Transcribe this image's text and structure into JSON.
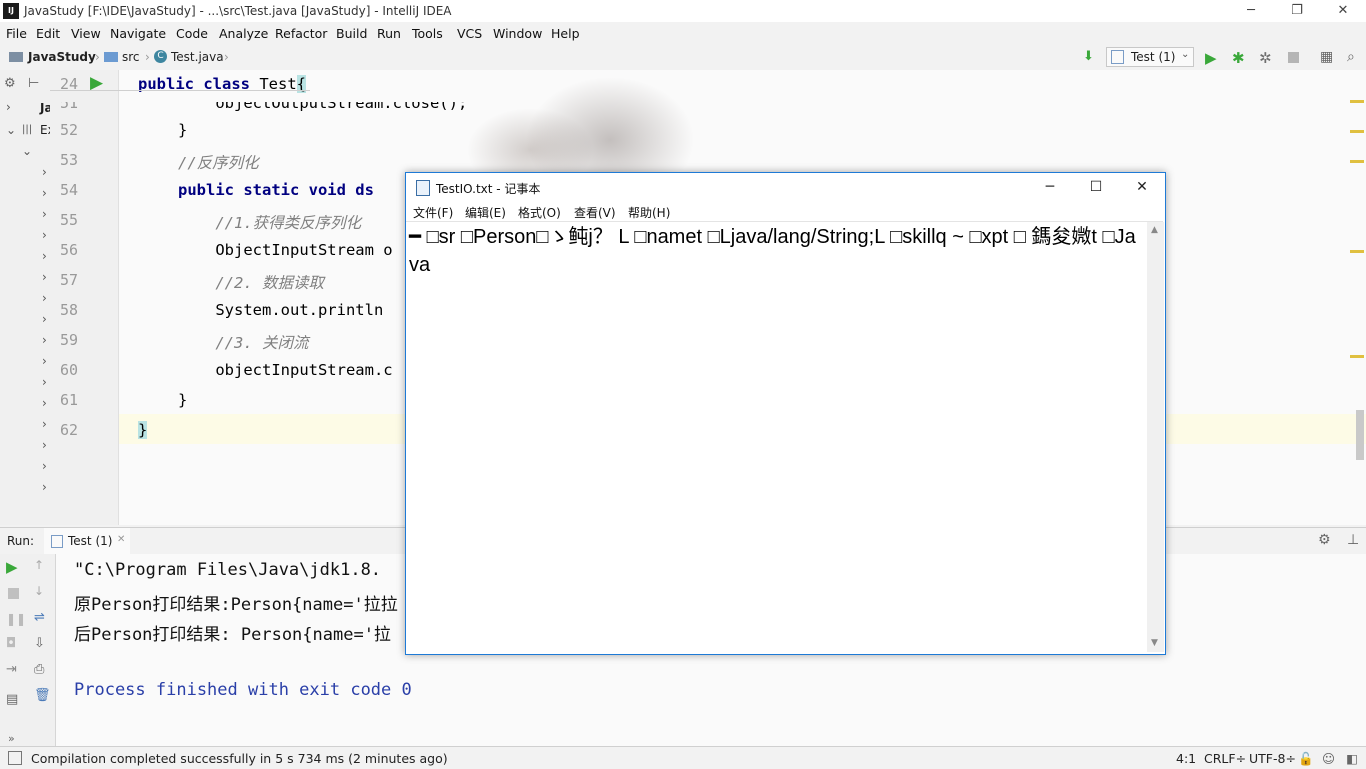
{
  "window": {
    "title": "JavaStudy [F:\\IDE\\JavaStudy] - ...\\src\\Test.java [JavaStudy] - IntelliJ IDEA",
    "logo": "IJ"
  },
  "menu": [
    "File",
    "Edit",
    "View",
    "Navigate",
    "Code",
    "Analyze",
    "Refactor",
    "Build",
    "Run",
    "Tools",
    "VCS",
    "Window",
    "Help"
  ],
  "breadcrumbs": [
    "JavaStudy",
    "src",
    "Test.java"
  ],
  "run_config": {
    "label": "Test (1)"
  },
  "project_tree": {
    "item1": "Ja",
    "item2": "Ex"
  },
  "editor": {
    "lines": [
      {
        "num": "24",
        "text": "public class Test{"
      },
      {
        "num": "51",
        "text": "    objectOutputStream.close();"
      },
      {
        "num": "52",
        "text": "}"
      },
      {
        "num": "53",
        "text": "//反序列化"
      },
      {
        "num": "54",
        "text": "public static void ds"
      },
      {
        "num": "55",
        "text": "    //1.获得类反序列化"
      },
      {
        "num": "56",
        "text": "    ObjectInputStream o"
      },
      {
        "num": "57",
        "text": "    //2. 数据读取"
      },
      {
        "num": "58",
        "text": "    System.out.println"
      },
      {
        "num": "59",
        "text": "    //3. 关闭流"
      },
      {
        "num": "60",
        "text": "    objectInputStream.c"
      },
      {
        "num": "61",
        "text": "}"
      },
      {
        "num": "62",
        "text": "}"
      }
    ]
  },
  "notepad": {
    "title": "TestIO.txt - 记事本",
    "menu": [
      "文件(F)",
      "编辑(E)",
      "格式(O)",
      "查看(V)",
      "帮助(H)"
    ],
    "content": "━ □sr □Person□ゝ鲀j？ L □namet □Ljava/lang/String;L □skillq ~ □xpt □ 鎷夋媺t □Java"
  },
  "run_panel": {
    "label": "Run:",
    "tab": "Test (1)",
    "console": [
      "\"C:\\Program Files\\Java\\jdk1.8.",
      "原Person打印结果:Person{name='拉拉",
      "后Person打印结果: Person{name='拉",
      "",
      "Process finished with exit code 0"
    ]
  },
  "status": {
    "message": "Compilation completed successfully in 5 s 734 ms (2 minutes ago)",
    "position": "4:1",
    "line_sep": "CRLF÷",
    "encoding": "UTF-8÷"
  },
  "colors": {
    "keyword": "#000080",
    "comment": "#808080",
    "field": "#660e7a",
    "console_finished": "#2a3fa8",
    "notepad_border": "#1e7ad6",
    "run_green": "#3aa83a"
  }
}
